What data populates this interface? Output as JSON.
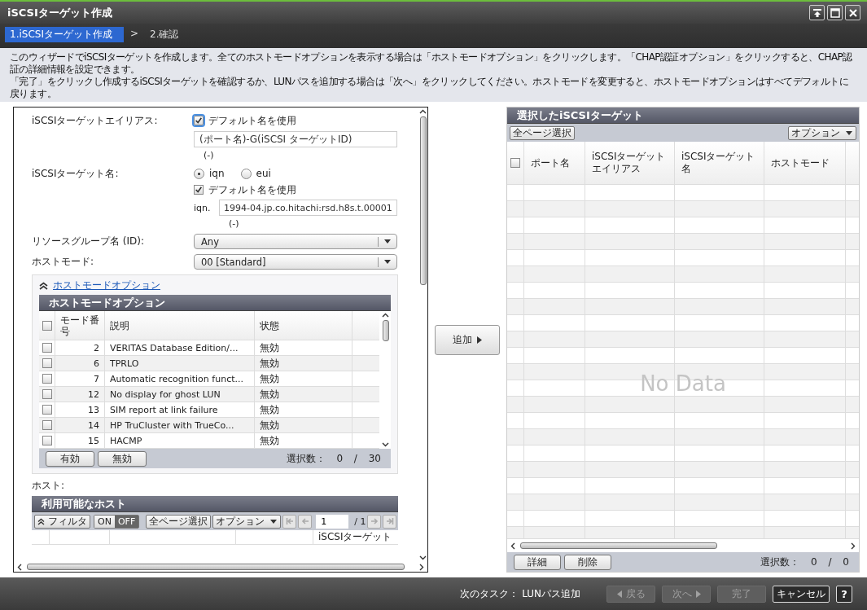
{
  "window": {
    "title": "iSCSIターゲット作成"
  },
  "steps": [
    {
      "label": "1.iSCSIターゲット作成",
      "selected": true
    },
    {
      "label": "2.確認",
      "selected": false
    }
  ],
  "step_separator": ">",
  "description": [
    "このウィザードでiSCSIターゲットを作成します。全てのホストモードオプションを表示する場合は「ホストモードオプション」をクリックします。「CHAP認証オプション」をクリックすると、CHAP認証の詳細情報を設定できます。",
    "「完了」をクリックし作成するiSCSIターゲットを確認するか、LUNパスを追加する場合は「次へ」をクリックしてください。ホストモードを変更すると、ホストモードオプションはすべてデフォルトに戻ります。"
  ],
  "form": {
    "alias": {
      "label": "iSCSIターゲットエイリアス:",
      "use_default": {
        "label": "デフォルト名を使用",
        "checked": true
      },
      "value": "(ポート名)-G(iSCSI ターゲットID)",
      "note": "(-)"
    },
    "target_name": {
      "label": "iSCSIターゲット名:",
      "formats": [
        {
          "label": "iqn",
          "selected": true
        },
        {
          "label": "eui",
          "selected": false
        }
      ],
      "use_default": {
        "label": "デフォルト名を使用",
        "checked": true
      },
      "prefix": "iqn.",
      "value": "1994-04.jp.co.hitachi:rsd.h8s.t.00001",
      "note": "(-)"
    },
    "resource_group": {
      "label": "リソースグループ名 (ID):",
      "value": "Any"
    },
    "host_mode": {
      "label": "ホストモード:",
      "value": "00 [Standard]"
    }
  },
  "host_mode_options": {
    "toggle": "ホストモードオプション",
    "expanded": true,
    "title": "ホストモードオプション",
    "header_checked": false,
    "columns": [
      "モード番号",
      "説明",
      "状態"
    ],
    "rows": [
      {
        "checked": false,
        "mode": "2",
        "description": "VERITAS Database Edition/...",
        "status": "無効"
      },
      {
        "checked": false,
        "mode": "6",
        "description": "TPRLO",
        "status": "無効"
      },
      {
        "checked": false,
        "mode": "7",
        "description": "Automatic recognition funct...",
        "status": "無効"
      },
      {
        "checked": false,
        "mode": "12",
        "description": "No display for ghost LUN",
        "status": "無効"
      },
      {
        "checked": false,
        "mode": "13",
        "description": "SIM report at link failure",
        "status": "無効"
      },
      {
        "checked": false,
        "mode": "14",
        "description": "HP TruCluster with TrueCo...",
        "status": "無効"
      },
      {
        "checked": false,
        "mode": "15",
        "description": "HACMP",
        "status": "無効"
      }
    ],
    "buttons": [
      "有効",
      "無効"
    ],
    "selection": "選択数： 0 / 30"
  },
  "hosts": {
    "label": "ホスト:",
    "title": "利用可能なホスト",
    "filter": "フィルタ",
    "filter_toggle": [
      {
        "label": "ON",
        "selected": false
      },
      {
        "label": "OFF",
        "selected": true
      }
    ],
    "select_all": "全ページ選択",
    "options": "オプション",
    "page": "1",
    "page_total": "/ 1",
    "column_5": "iSCSIターゲット"
  },
  "add_button": "追加",
  "selected_targets": {
    "title": "選択したiSCSIターゲット",
    "select_all": "全ページ選択",
    "options": "オプション",
    "header_checked": false,
    "columns": [
      "ポート名",
      "iSCSIターゲットエイリアス",
      "iSCSIターゲット名",
      "ホストモード"
    ],
    "empty_text": "No Data",
    "buttons": [
      "詳細",
      "削除"
    ],
    "selection": "選択数： 0 / 0"
  },
  "footer": {
    "next_task": "次のタスク： LUNパス追加",
    "buttons": [
      {
        "kind": "back",
        "label": "戻る",
        "disabled": true
      },
      {
        "kind": "next",
        "label": "次へ",
        "disabled": true
      },
      {
        "kind": "finish",
        "label": "完了",
        "disabled": true
      },
      {
        "kind": "cancel",
        "label": "キャンセル",
        "disabled": false
      },
      {
        "kind": "help",
        "label": "?",
        "disabled": false
      }
    ]
  }
}
